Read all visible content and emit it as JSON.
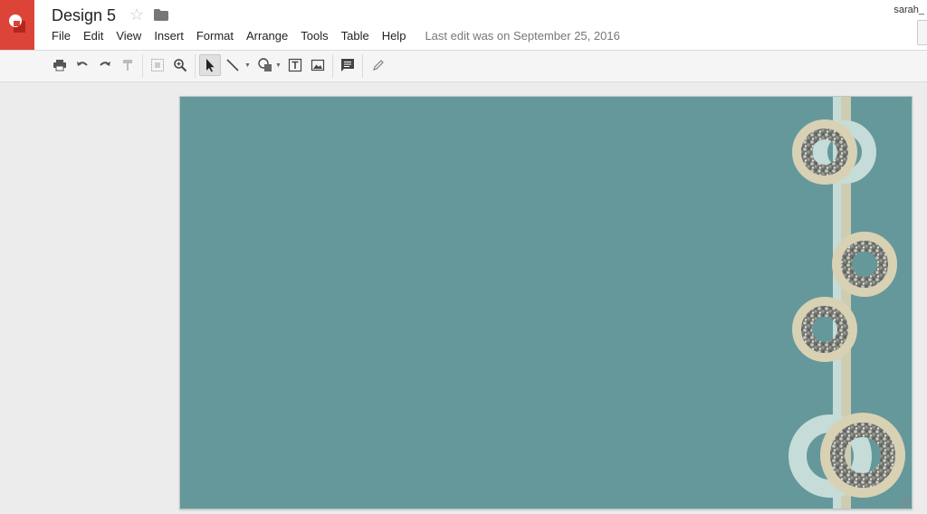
{
  "app": {
    "title": "Design 5",
    "user": "sarah_",
    "last_edit": "Last edit was on September 25, 2016",
    "brand_color": "#db4437"
  },
  "menu": {
    "items": [
      "File",
      "Edit",
      "View",
      "Insert",
      "Format",
      "Arrange",
      "Tools",
      "Table",
      "Help"
    ]
  },
  "toolbar": {
    "buttons": [
      {
        "name": "print-icon"
      },
      {
        "name": "undo-icon"
      },
      {
        "name": "redo-icon"
      },
      {
        "name": "paint-format-icon"
      },
      {
        "name": "snap-to-grid-icon"
      },
      {
        "name": "zoom-icon"
      },
      {
        "name": "select-icon",
        "active": true
      },
      {
        "name": "line-icon"
      },
      {
        "name": "shape-icon"
      },
      {
        "name": "text-box-icon"
      },
      {
        "name": "image-icon"
      },
      {
        "name": "comment-icon"
      },
      {
        "name": "pencil-icon"
      }
    ]
  },
  "slide": {
    "background_color": "#65989a",
    "stripe_color": "#cfcdb1",
    "ring_color": "#d8d1b4",
    "ghost_ring_color": "#c5dcd9"
  }
}
